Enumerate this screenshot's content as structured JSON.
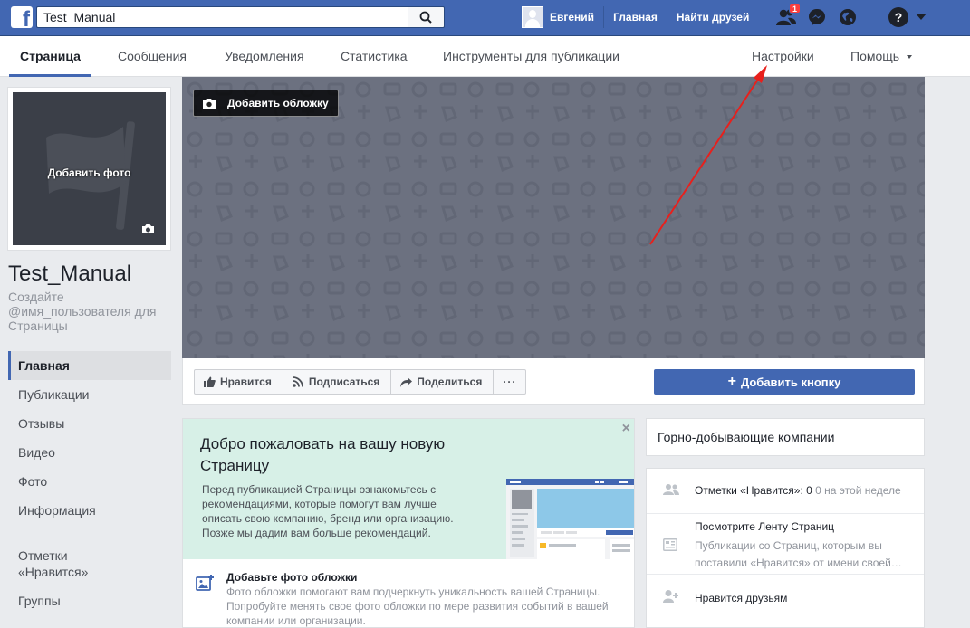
{
  "topbar": {
    "search_value": "Test_Manual",
    "user_name": "Евгений",
    "home_link": "Главная",
    "find_friends_link": "Найти друзей",
    "friend_requests_badge": "1",
    "brand_color": "#4267b2"
  },
  "page_nav": {
    "tabs": [
      {
        "label": "Страница"
      },
      {
        "label": "Сообщения"
      },
      {
        "label": "Уведомления"
      },
      {
        "label": "Статистика"
      },
      {
        "label": "Инструменты для публикации"
      },
      {
        "label": "Настройки"
      },
      {
        "label": "Помощь"
      }
    ]
  },
  "profile": {
    "add_photo_label": "Добавить фото",
    "page_name": "Test_Manual",
    "create_username": "Создайте @имя_пользователя для Страницы"
  },
  "left_nav": {
    "items": [
      {
        "label": "Главная"
      },
      {
        "label": "Публикации"
      },
      {
        "label": "Отзывы"
      },
      {
        "label": "Видео"
      },
      {
        "label": "Фото"
      },
      {
        "label": "Информация"
      },
      {
        "label": "Отметки «Нравится»"
      },
      {
        "label": "Группы"
      }
    ]
  },
  "cover": {
    "add_cover_label": "Добавить обложку"
  },
  "actions": {
    "like": "Нравится",
    "follow": "Подписаться",
    "share": "Поделиться",
    "more": "···",
    "add_button": "Добавить кнопку"
  },
  "welcome": {
    "title": "Добро пожаловать на вашу новую Страницу",
    "text": "Перед публикацией Страницы ознакомьтесь с рекомендациями, которые помогут вам лучше описать свою компанию, бренд или организацию. Позже мы дадим вам больше рекомендаций.",
    "close": "×",
    "tip_title": "Добавьте фото обложки",
    "tip_text": "Фото обложки помогают вам подчеркнуть уникальность вашей Страницы. Попробуйте менять свое фото обложки по мере развития событий в вашей компании или организации."
  },
  "right": {
    "category": "Горно-добывающие компании",
    "likes_label": "Отметки «Нравится»:",
    "likes_count": "0",
    "likes_week": "0 на этой неделе",
    "feed_title": "Посмотрите Ленту Страниц",
    "feed_text": "Публикации со Страниц, которым вы поставили «Нравится» от имени своей…",
    "invite_friends": "Нравится друзьям"
  }
}
